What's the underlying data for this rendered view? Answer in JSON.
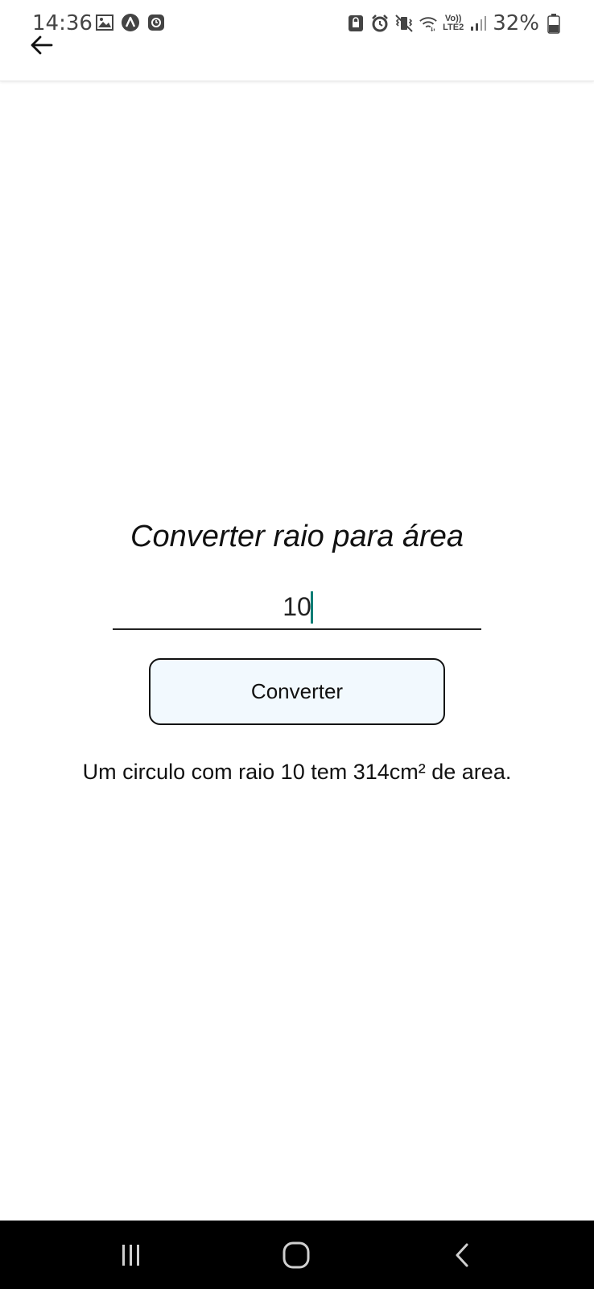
{
  "status_bar": {
    "time": "14:36",
    "battery_percent": "32%",
    "network_label_top": "Vo))",
    "network_label_bottom": "LTE2",
    "left_icons": [
      "gallery-icon",
      "app-a-icon",
      "app-notification-icon"
    ],
    "right_icons": [
      "lock-icon",
      "alarm-icon",
      "vibrate-icon",
      "wifi-icon",
      "signal-icon",
      "battery-icon"
    ]
  },
  "app_bar": {
    "back_icon": "arrow-left-icon"
  },
  "main": {
    "title": "Converter raio para área",
    "radius_value": "10",
    "convert_button_label": "Converter",
    "result_text": "Um circulo com raio 10 tem 314cm² de area."
  },
  "nav_bar": {
    "icons": [
      "recent-apps-icon",
      "home-icon",
      "back-nav-icon"
    ]
  },
  "colors": {
    "accent_caret": "#0b7d75",
    "button_background": "#f2f9fe",
    "nav_bar_background": "#000000"
  }
}
